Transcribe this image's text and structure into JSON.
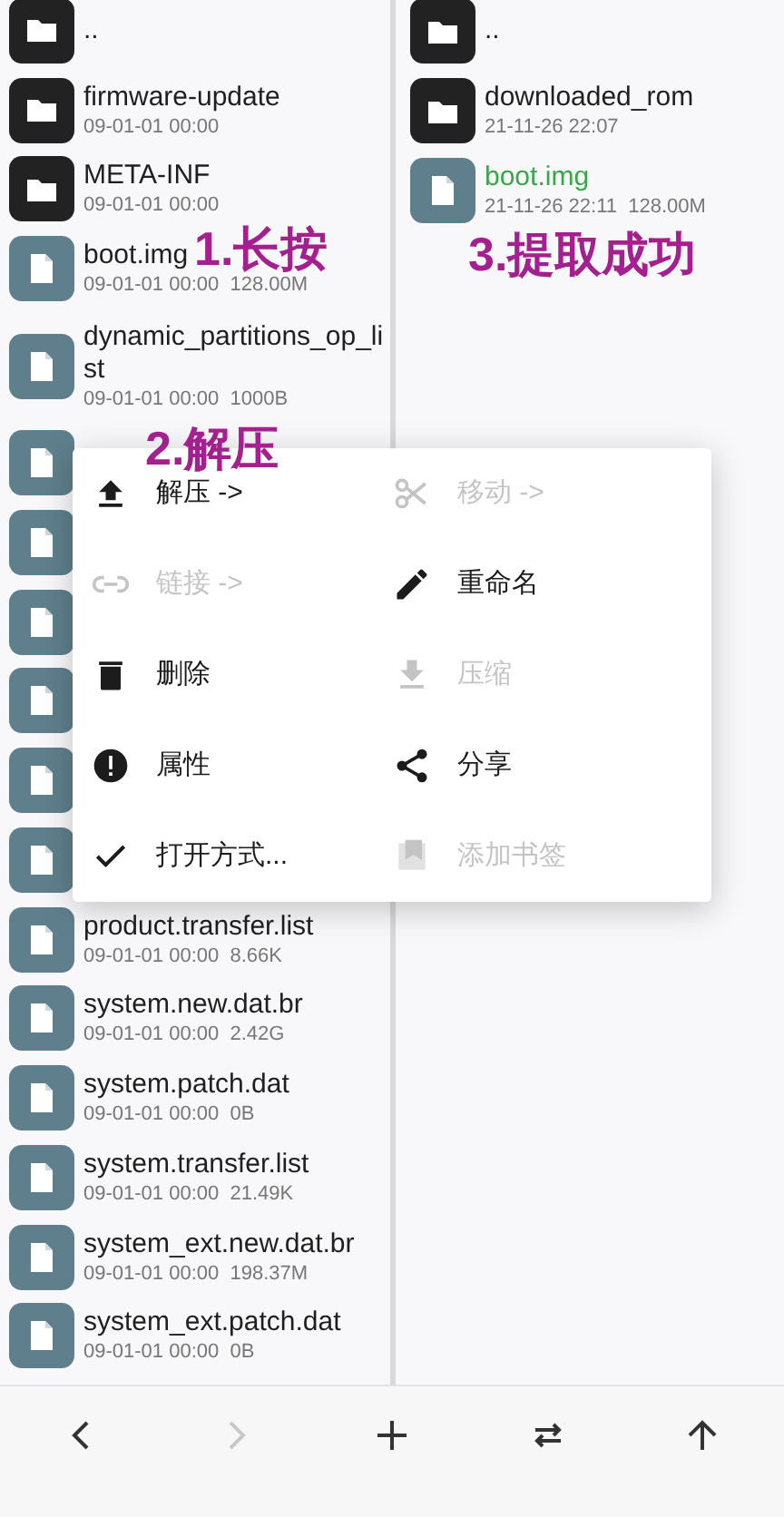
{
  "left_pane": {
    "items": [
      {
        "kind": "folder",
        "name": "..",
        "highlighted": false
      },
      {
        "kind": "folder",
        "name": "firmware-update",
        "meta": "09-01-01 00:00",
        "highlighted": false
      },
      {
        "kind": "folder",
        "name": "META-INF",
        "meta": "09-01-01 00:00",
        "highlighted": false
      },
      {
        "kind": "file",
        "name": "boot.img",
        "meta": "09-01-01 00:00  128.00M",
        "highlighted": false
      },
      {
        "kind": "file",
        "name": "dynamic_partitions_op_list",
        "meta": "09-01-01 00:00  1000B",
        "highlighted": false
      },
      {
        "kind": "file"
      },
      {
        "kind": "file"
      },
      {
        "kind": "file"
      },
      {
        "kind": "file"
      },
      {
        "kind": "file"
      },
      {
        "kind": "file"
      },
      {
        "kind": "file",
        "name": "product.transfer.list",
        "meta": "09-01-01 00:00  8.66K",
        "highlighted": false
      },
      {
        "kind": "file",
        "name": "system.new.dat.br",
        "meta": "09-01-01 00:00  2.42G",
        "highlighted": false
      },
      {
        "kind": "file",
        "name": "system.patch.dat",
        "meta": "09-01-01 00:00  0B",
        "highlighted": false
      },
      {
        "kind": "file",
        "name": "system.transfer.list",
        "meta": "09-01-01 00:00  21.49K",
        "highlighted": false
      },
      {
        "kind": "file",
        "name": "system_ext.new.dat.br",
        "meta": "09-01-01 00:00  198.37M",
        "highlighted": false
      },
      {
        "kind": "file",
        "name": "system_ext.patch.dat",
        "meta": "09-01-01 00:00  0B",
        "highlighted": false
      }
    ]
  },
  "right_pane": {
    "items": [
      {
        "kind": "folder",
        "name": "..",
        "highlighted": false
      },
      {
        "kind": "folder",
        "name": "downloaded_rom",
        "meta": "21-11-26 22:07",
        "highlighted": false
      },
      {
        "kind": "file",
        "name": "boot.img",
        "meta": "21-11-26 22:11  128.00M",
        "highlighted": true
      }
    ]
  },
  "context_menu": {
    "items": [
      {
        "label": "解压 ->",
        "disabled": false
      },
      {
        "label": "移动 ->",
        "disabled": true
      },
      {
        "label": "链接 ->",
        "disabled": true
      },
      {
        "label": "重命名",
        "disabled": false
      },
      {
        "label": "删除",
        "disabled": false
      },
      {
        "label": "压缩",
        "disabled": true
      },
      {
        "label": "属性",
        "disabled": false
      },
      {
        "label": "分享",
        "disabled": false
      },
      {
        "label": "打开方式...",
        "disabled": false
      },
      {
        "label": "添加书签",
        "disabled": true
      }
    ]
  },
  "annotations": [
    "1.长按",
    "2.解压",
    "3.提取成功"
  ],
  "bottom_bar": {
    "buttons": [
      {
        "disabled": false
      },
      {
        "disabled": true
      },
      {
        "disabled": false
      },
      {
        "disabled": false
      },
      {
        "disabled": false
      }
    ]
  }
}
